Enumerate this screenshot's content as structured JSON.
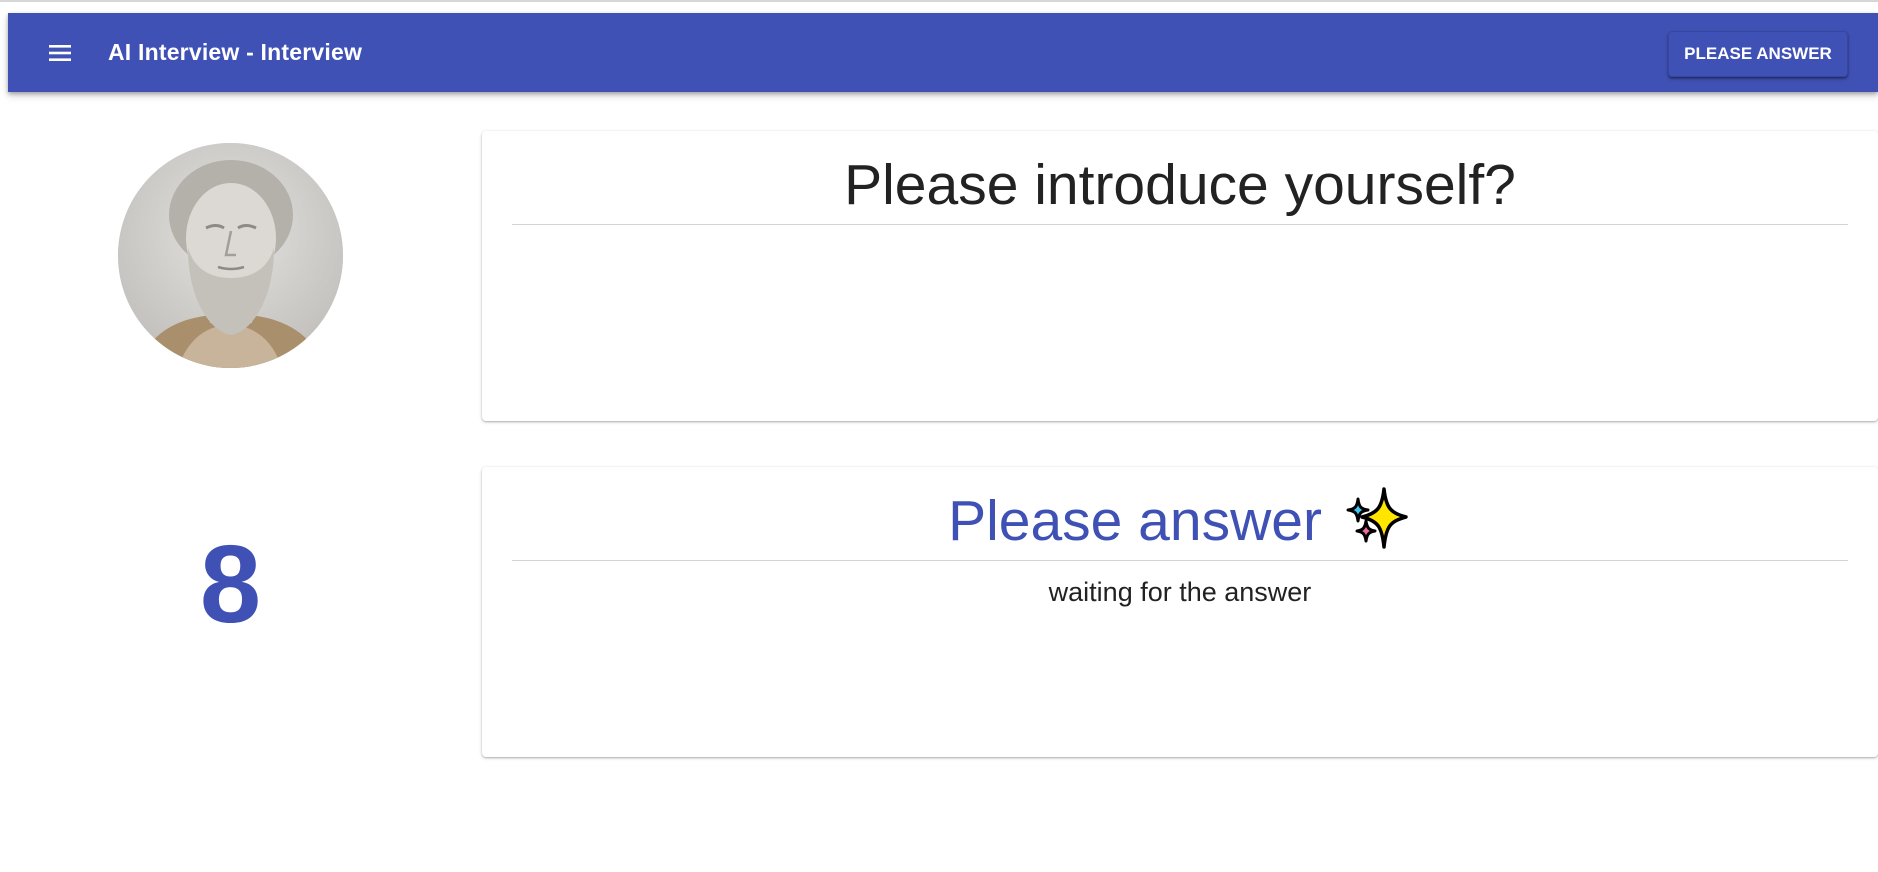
{
  "header": {
    "title": "AI Interview - Interview",
    "menu_icon": "hamburger-menu-icon",
    "action_label": "PLEASE ANSWER"
  },
  "left_panel": {
    "avatar": "bust-portrait-avatar",
    "counter": "8"
  },
  "question_card": {
    "title": "Please introduce yourself?"
  },
  "answer_card": {
    "title": "Please answer",
    "icon": "sparkles-icon",
    "status": "waiting for the answer"
  },
  "colors": {
    "primary": "#3f51b5",
    "text": "#222222",
    "on_primary": "#ffffff"
  }
}
